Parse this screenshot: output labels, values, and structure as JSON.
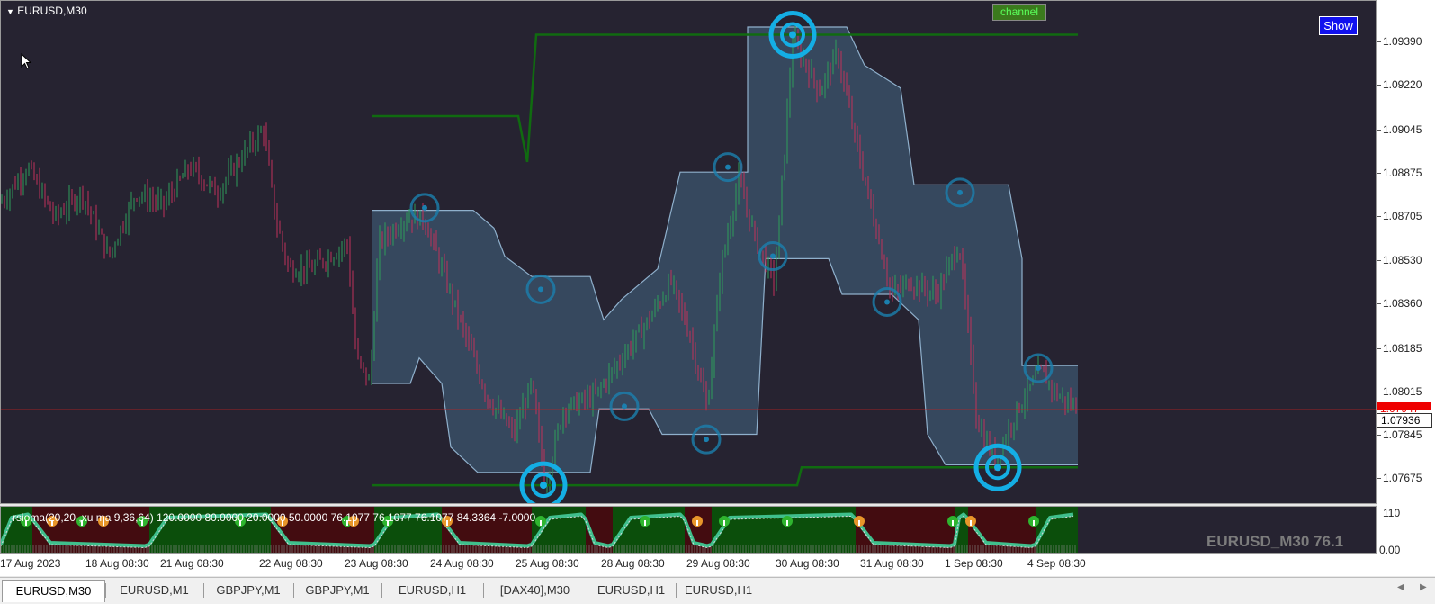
{
  "window": {
    "title": "EURUSD,M30",
    "buttons": {
      "show": "Show",
      "channel": "channel"
    },
    "current_price": "1.07936",
    "current_price_red_label": "1.07947"
  },
  "price_axis": [
    "1.09390",
    "1.09220",
    "1.09045",
    "1.08875",
    "1.08705",
    "1.08530",
    "1.08360",
    "1.08185",
    "1.08015",
    "1.07845",
    "1.07675"
  ],
  "sub_window": {
    "indicator_label": "rsioma(20,20 ,xu ma 9,36,64) 120.0000 80.0000 20.0000 50.0000 76.1077 76.1077 76.1077 84.3364 -7.0000",
    "axis_top": "110",
    "axis_bottom": "0.00",
    "watermark": "EURUSD_M30  76.1"
  },
  "time_axis": [
    "17 Aug 2023",
    "18 Aug 08:30",
    "21 Aug 08:30",
    "22 Aug 08:30",
    "23 Aug 08:30",
    "24 Aug 08:30",
    "25 Aug 08:30",
    "28 Aug 08:30",
    "29 Aug 08:30",
    "30 Aug 08:30",
    "31 Aug 08:30",
    "1 Sep 08:30",
    "4 Sep 08:30"
  ],
  "tabs": [
    "EURUSD,M30",
    "EURUSD,M1",
    "GBPJPY,M1",
    "GBPJPY,M1",
    "EURUSD,H1",
    "[DAX40],M30",
    "EURUSD,H1",
    "EURUSD,H1"
  ],
  "active_tab": 0,
  "colors": {
    "background": "#262331",
    "bull": "#2e9e5a",
    "bear": "#c0325a",
    "band_fill": "#3a4f66",
    "band_line": "#8fb0cc",
    "channel": "#106b10",
    "signal_ring": "#14aee4",
    "price_line": "#c82020"
  },
  "chart_data": {
    "type": "line",
    "title": "EURUSD,M30",
    "ylim": [
      1.076,
      1.095
    ],
    "price_path": [
      [
        0,
        1.0876
      ],
      [
        30,
        1.089
      ],
      [
        60,
        1.087
      ],
      [
        90,
        1.088
      ],
      [
        120,
        1.0855
      ],
      [
        150,
        1.088
      ],
      [
        180,
        1.0875
      ],
      [
        210,
        1.089
      ],
      [
        240,
        1.088
      ],
      [
        270,
        1.0895
      ],
      [
        292,
        1.0905
      ],
      [
        305,
        1.087
      ],
      [
        320,
        1.085
      ],
      [
        345,
        1.085
      ],
      [
        385,
        1.086
      ],
      [
        395,
        1.0815
      ],
      [
        410,
        1.0805
      ],
      [
        420,
        1.086
      ],
      [
        450,
        1.087
      ],
      [
        470,
        1.087
      ],
      [
        490,
        1.085
      ],
      [
        510,
        1.083
      ],
      [
        540,
        1.08
      ],
      [
        570,
        1.0785
      ],
      [
        590,
        1.0805
      ],
      [
        605,
        1.0765
      ],
      [
        625,
        1.0795
      ],
      [
        660,
        1.08
      ],
      [
        690,
        1.0815
      ],
      [
        720,
        1.083
      ],
      [
        745,
        1.0845
      ],
      [
        765,
        1.0825
      ],
      [
        785,
        1.0795
      ],
      [
        800,
        1.085
      ],
      [
        820,
        1.0885
      ],
      [
        840,
        1.086
      ],
      [
        860,
        1.0845
      ],
      [
        880,
        1.094
      ],
      [
        910,
        1.092
      ],
      [
        930,
        1.0935
      ],
      [
        950,
        1.09
      ],
      [
        970,
        1.087
      ],
      [
        990,
        1.084
      ],
      [
        1010,
        1.0845
      ],
      [
        1040,
        1.084
      ],
      [
        1065,
        1.086
      ],
      [
        1085,
        1.079
      ],
      [
        1105,
        1.0775
      ],
      [
        1130,
        1.0795
      ],
      [
        1155,
        1.081
      ],
      [
        1175,
        1.08
      ],
      [
        1197,
        1.0795
      ]
    ],
    "band_upper": [
      [
        413,
        1.0873
      ],
      [
        525,
        1.0873
      ],
      [
        548,
        1.0866
      ],
      [
        560,
        1.0855
      ],
      [
        590,
        1.0847
      ],
      [
        655,
        1.0847
      ],
      [
        670,
        1.083
      ],
      [
        690,
        1.0838
      ],
      [
        730,
        1.085
      ],
      [
        755,
        1.0888
      ],
      [
        830,
        1.0888
      ],
      [
        830,
        1.0945
      ],
      [
        940,
        1.0945
      ],
      [
        960,
        1.093
      ],
      [
        1000,
        1.0921
      ],
      [
        1015,
        1.0883
      ],
      [
        1120,
        1.0883
      ],
      [
        1135,
        1.0854
      ],
      [
        1135,
        1.0812
      ],
      [
        1197,
        1.0812
      ]
    ],
    "band_lower": [
      [
        413,
        1.0805
      ],
      [
        455,
        1.0805
      ],
      [
        465,
        1.0815
      ],
      [
        490,
        1.0805
      ],
      [
        500,
        1.078
      ],
      [
        530,
        1.077
      ],
      [
        655,
        1.077
      ],
      [
        665,
        1.0795
      ],
      [
        720,
        1.0795
      ],
      [
        735,
        1.0785
      ],
      [
        840,
        1.0785
      ],
      [
        850,
        1.0854
      ],
      [
        920,
        1.0854
      ],
      [
        935,
        1.084
      ],
      [
        990,
        1.084
      ],
      [
        1020,
        1.083
      ],
      [
        1030,
        1.0785
      ],
      [
        1050,
        1.0773
      ],
      [
        1197,
        1.0773
      ]
    ],
    "channel_upper": [
      [
        413,
        1.091
      ],
      [
        575,
        1.091
      ],
      [
        585,
        1.0892
      ],
      [
        595,
        1.0942
      ],
      [
        1197,
        1.0942
      ]
    ],
    "channel_lower": [
      [
        413,
        1.0765
      ],
      [
        885,
        1.0765
      ],
      [
        890,
        1.0772
      ],
      [
        1197,
        1.0772
      ]
    ],
    "signals": [
      {
        "x": 471,
        "p": 1.0874,
        "big": false
      },
      {
        "x": 600,
        "p": 1.0842,
        "big": false
      },
      {
        "x": 603,
        "p": 1.0765,
        "big": true
      },
      {
        "x": 693,
        "p": 1.0796,
        "big": false
      },
      {
        "x": 784,
        "p": 1.0783,
        "big": false
      },
      {
        "x": 808,
        "p": 1.089,
        "big": false
      },
      {
        "x": 858,
        "p": 1.0855,
        "big": false
      },
      {
        "x": 880,
        "p": 1.0942,
        "big": true
      },
      {
        "x": 985,
        "p": 1.0837,
        "big": false
      },
      {
        "x": 1066,
        "p": 1.088,
        "big": false
      },
      {
        "x": 1108,
        "p": 1.0772,
        "big": true
      },
      {
        "x": 1153,
        "p": 1.0811,
        "big": false
      }
    ],
    "sub_zones": [
      {
        "x0": 0,
        "x1": 35,
        "c": "green"
      },
      {
        "x0": 35,
        "x1": 165,
        "c": "red"
      },
      {
        "x0": 165,
        "x1": 300,
        "c": "green"
      },
      {
        "x0": 300,
        "x1": 415,
        "c": "red"
      },
      {
        "x0": 415,
        "x1": 490,
        "c": "green"
      },
      {
        "x0": 490,
        "x1": 590,
        "c": "red"
      },
      {
        "x0": 590,
        "x1": 650,
        "c": "green"
      },
      {
        "x0": 650,
        "x1": 680,
        "c": "red"
      },
      {
        "x0": 680,
        "x1": 760,
        "c": "green"
      },
      {
        "x0": 760,
        "x1": 790,
        "c": "red"
      },
      {
        "x0": 790,
        "x1": 950,
        "c": "green"
      },
      {
        "x0": 950,
        "x1": 1060,
        "c": "red"
      },
      {
        "x0": 1060,
        "x1": 1075,
        "c": "green"
      },
      {
        "x0": 1075,
        "x1": 1150,
        "c": "red"
      },
      {
        "x0": 1150,
        "x1": 1197,
        "c": "green"
      }
    ],
    "sub_markers": [
      {
        "x": 28,
        "t": "up"
      },
      {
        "x": 57,
        "t": "down"
      },
      {
        "x": 90,
        "t": "up"
      },
      {
        "x": 114,
        "t": "down"
      },
      {
        "x": 157,
        "t": "up"
      },
      {
        "x": 266,
        "t": "up"
      },
      {
        "x": 313,
        "t": "down"
      },
      {
        "x": 385,
        "t": "up"
      },
      {
        "x": 392,
        "t": "down"
      },
      {
        "x": 430,
        "t": "up"
      },
      {
        "x": 496,
        "t": "down"
      },
      {
        "x": 600,
        "t": "up"
      },
      {
        "x": 716,
        "t": "up"
      },
      {
        "x": 774,
        "t": "down"
      },
      {
        "x": 804,
        "t": "up"
      },
      {
        "x": 874,
        "t": "up"
      },
      {
        "x": 954,
        "t": "down"
      },
      {
        "x": 1058,
        "t": "up"
      },
      {
        "x": 1078,
        "t": "down"
      },
      {
        "x": 1148,
        "t": "up"
      }
    ]
  }
}
